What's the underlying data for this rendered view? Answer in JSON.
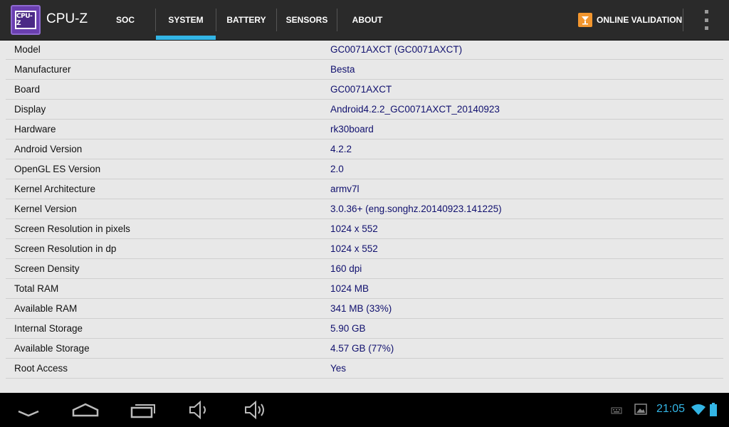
{
  "app": {
    "title": "CPU-Z",
    "logo_text": "CPU-Z"
  },
  "tabs": [
    {
      "label": "SOC"
    },
    {
      "label": "SYSTEM",
      "active": true
    },
    {
      "label": "BATTERY"
    },
    {
      "label": "SENSORS"
    },
    {
      "label": "ABOUT"
    }
  ],
  "actions": {
    "validation_label": "ONLINE VALIDATION"
  },
  "accent_color": "#33b5e5",
  "value_color": "#10106e",
  "rows": [
    {
      "label": "Model",
      "value": "GC0071AXCT (GC0071AXCT)"
    },
    {
      "label": "Manufacturer",
      "value": "Besta"
    },
    {
      "label": "Board",
      "value": "GC0071AXCT"
    },
    {
      "label": "Display",
      "value": "Android4.2.2_GC0071AXCT_20140923"
    },
    {
      "label": "Hardware",
      "value": "rk30board"
    },
    {
      "label": "Android Version",
      "value": "4.2.2"
    },
    {
      "label": "OpenGL ES Version",
      "value": "2.0"
    },
    {
      "label": "Kernel Architecture",
      "value": "armv7l"
    },
    {
      "label": "Kernel Version",
      "value": "3.0.36+ (eng.songhz.20140923.141225)"
    },
    {
      "label": "Screen Resolution in pixels",
      "value": "1024 x 552"
    },
    {
      "label": "Screen Resolution in dp",
      "value": "1024 x 552"
    },
    {
      "label": "Screen Density",
      "value": "160 dpi"
    },
    {
      "label": "Total RAM",
      "value": "1024 MB"
    },
    {
      "label": "Available RAM",
      "value": "341 MB  (33%)"
    },
    {
      "label": "Internal Storage",
      "value": "5.90 GB"
    },
    {
      "label": "Available Storage",
      "value": "4.57 GB (77%)"
    },
    {
      "label": "Root Access",
      "value": "Yes"
    }
  ],
  "statusbar": {
    "time": "21:05",
    "icons": [
      "keyboard-icon",
      "screenshot-icon",
      "wifi-icon",
      "battery-icon"
    ]
  },
  "navbar": {
    "icons": [
      "back-icon",
      "home-icon",
      "recent-apps-icon",
      "volume-down-icon",
      "volume-up-icon"
    ]
  }
}
